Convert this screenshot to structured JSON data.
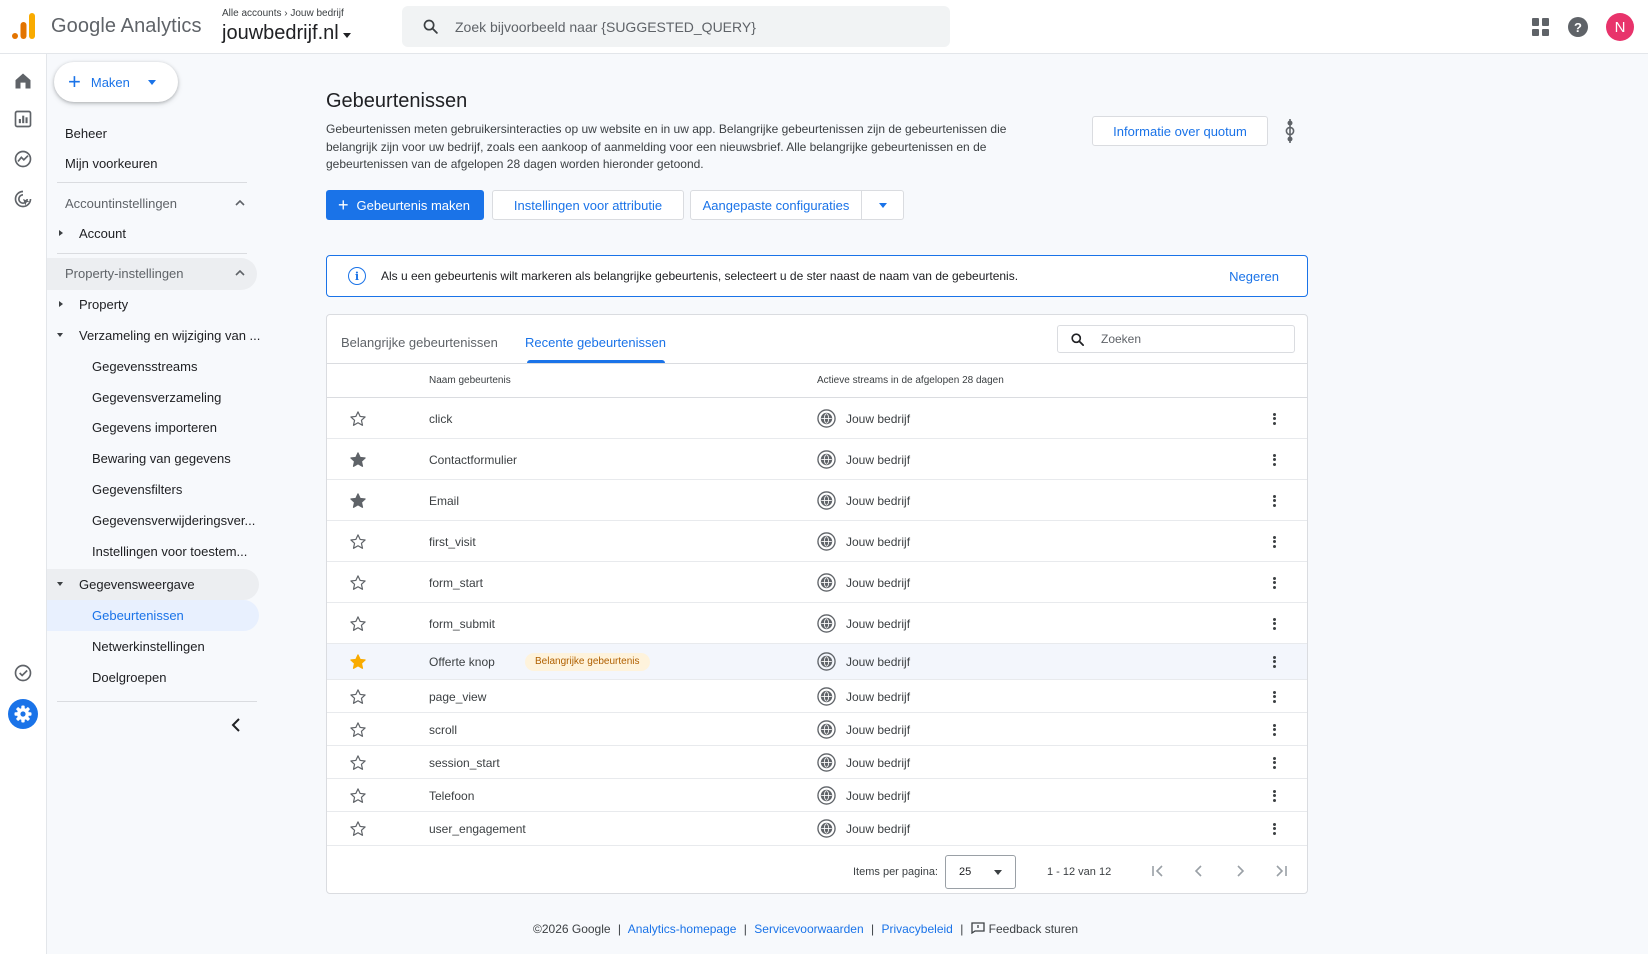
{
  "app": {
    "name": "Google Analytics",
    "accent": "#1a73e8"
  },
  "header": {
    "breadcrumb": [
      "Alle accounts",
      "Jouw bedrijf"
    ],
    "property": "jouwbedrijf.nl",
    "search_placeholder": "Zoek bijvoorbeeld naar {SUGGESTED_QUERY}",
    "avatar_initial": "N",
    "help_glyph": "?"
  },
  "sidebar": {
    "create_label": "Maken",
    "beheer": "Beheer",
    "voorkeuren": "Mijn voorkeuren",
    "account_settings": "Accountinstellingen",
    "account": "Account",
    "property_settings": "Property-instellingen",
    "property": "Property",
    "collection": "Verzameling en wijziging van ...",
    "collection_items": [
      "Gegevensstreams",
      "Gegevensverzameling",
      "Gegevens importeren",
      "Bewaring van gegevens",
      "Gegevensfilters",
      "Gegevensverwijderingsver...",
      "Instellingen voor toestem..."
    ],
    "display": "Gegevensweergave",
    "display_items": [
      "Gebeurtenissen",
      "Netwerkinstellingen",
      "Doelgroepen"
    ]
  },
  "main": {
    "title": "Gebeurtenissen",
    "description": "Gebeurtenissen meten gebruikersinteracties op uw website en in uw app. Belangrijke gebeurtenissen zijn de gebeurtenissen die belangrijk zijn voor uw bedrijf, zoals een aankoop of aanmelding voor een nieuwsbrief. Alle belangrijke gebeurtenissen en de gebeurtenissen van de afgelopen 28 dagen worden hieronder getoond.",
    "quota_button": "Informatie over quotum",
    "create_event": "Gebeurtenis maken",
    "attribution": "Instellingen voor attributie",
    "custom_configs": "Aangepaste configuraties",
    "info_glyph": "i",
    "banner_text": "Als u een gebeurtenis wilt markeren als belangrijke gebeurtenis, selecteert u de ster naast de naam van de gebeurtenis.",
    "banner_dismiss": "Negeren",
    "tabs": [
      "Belangrijke gebeurtenissen",
      "Recente gebeurtenissen"
    ],
    "table_search_placeholder": "Zoeken",
    "columns": [
      "Naam gebeurtenis",
      "Actieve streams in de afgelopen 28 dagen"
    ],
    "rows": [
      {
        "name": "click",
        "stream": "Jouw bedrijf",
        "star": "outline"
      },
      {
        "name": "Contactformulier",
        "stream": "Jouw bedrijf",
        "star": "filled-grey"
      },
      {
        "name": "Email",
        "stream": "Jouw bedrijf",
        "star": "filled-grey"
      },
      {
        "name": "first_visit",
        "stream": "Jouw bedrijf",
        "star": "outline"
      },
      {
        "name": "form_start",
        "stream": "Jouw bedrijf",
        "star": "outline"
      },
      {
        "name": "form_submit",
        "stream": "Jouw bedrijf",
        "star": "outline"
      },
      {
        "name": "Offerte knop",
        "stream": "Jouw bedrijf",
        "star": "filled-gold",
        "badge": "Belangrijke gebeurtenis"
      },
      {
        "name": "page_view",
        "stream": "Jouw bedrijf",
        "star": "outline"
      },
      {
        "name": "scroll",
        "stream": "Jouw bedrijf",
        "star": "outline"
      },
      {
        "name": "session_start",
        "stream": "Jouw bedrijf",
        "star": "outline"
      },
      {
        "name": "Telefoon",
        "stream": "Jouw bedrijf",
        "star": "outline"
      },
      {
        "name": "user_engagement",
        "stream": "Jouw bedrijf",
        "star": "outline"
      }
    ],
    "items_per_page_label": "Items per pagina:",
    "items_per_page": "25",
    "range": "1 - 12 van 12"
  },
  "footer": {
    "copyright": "©2026 Google",
    "home": "Analytics-homepage",
    "terms": "Servicevoorwaarden",
    "privacy": "Privacybeleid",
    "feedback": "Feedback sturen",
    "separator": "|"
  }
}
